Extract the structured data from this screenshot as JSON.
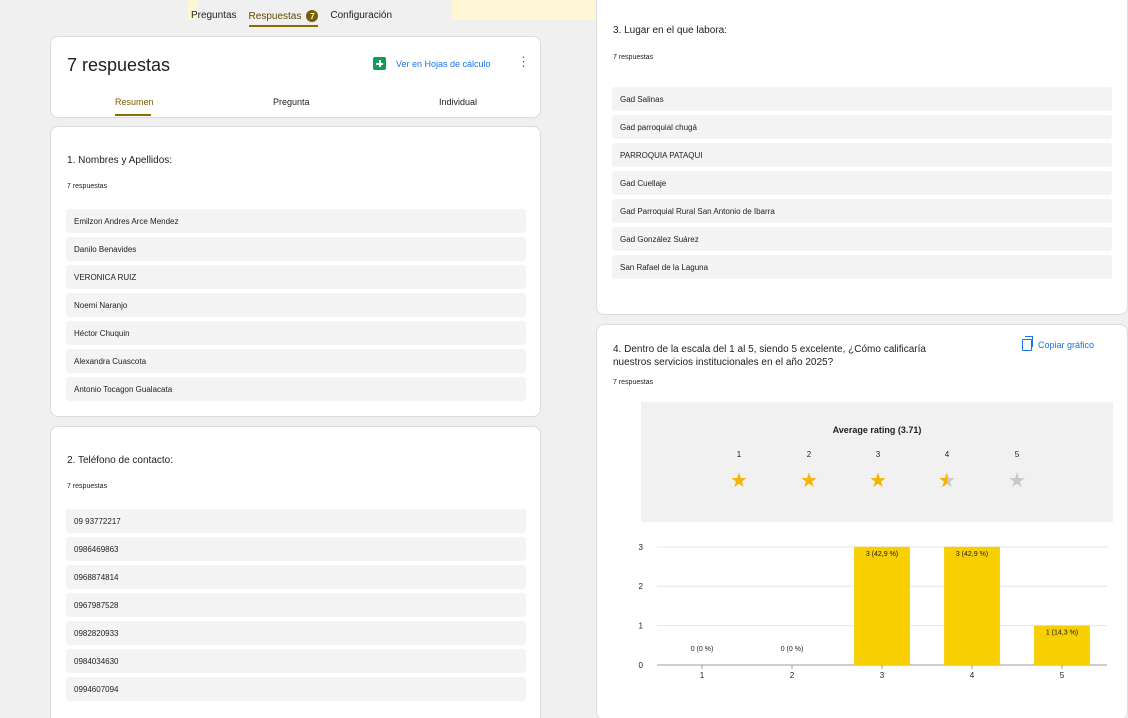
{
  "nav": {
    "tabs": [
      {
        "label": "Preguntas"
      },
      {
        "label": "Respuestas",
        "badge": "7"
      },
      {
        "label": "Configuración"
      }
    ]
  },
  "summary": {
    "title": "7 respuestas",
    "sheets_label": "Ver en Hojas de cálculo",
    "tabs": [
      "Resumen",
      "Pregunta",
      "Individual"
    ]
  },
  "q1": {
    "title": "1.  Nombres y Apellidos:",
    "count": "7 respuestas",
    "answers": [
      "Emilzon Andres Arce Mendez",
      "Danilo Benavides",
      "VERONICA RUIZ",
      "Noemi Naranjo",
      "Héctor Chuquin",
      "Alexandra Cuascota",
      "Antonio Tocagon Gualacata"
    ]
  },
  "q2": {
    "title": "2. Teléfono de contacto:",
    "count": "7 respuestas",
    "answers": [
      "09 93772217",
      "0986469863",
      "0968874814",
      "0967987528",
      "0982820933",
      "0984034630",
      "0994607094"
    ]
  },
  "q3": {
    "title": "3. Lugar en el que labora:",
    "count": "7 respuestas",
    "answers": [
      "Gad Salinas",
      "Gad parroquial chugá",
      "PARROQUIA PATAQUI",
      "Gad Cuellaje",
      "Gad Parroquial Rural San Antonio de Ibarra",
      "Gad González Suárez",
      "San Rafael de la Laguna"
    ]
  },
  "q4": {
    "title_line1": "4. Dentro de la escala del 1 al 5, siendo 5 excelente,  ¿Cómo calificaría",
    "title_line2": "nuestros servicios institucionales en el año 2025?",
    "count": "7 respuestas",
    "copy_label": "Copiar gráfico",
    "rating_label": "Average rating (3.71)",
    "stars": [
      {
        "num": "1",
        "fill": 1
      },
      {
        "num": "2",
        "fill": 1
      },
      {
        "num": "3",
        "fill": 1
      },
      {
        "num": "4",
        "fill": 0.5
      },
      {
        "num": "5",
        "fill": 0
      }
    ]
  },
  "colors": {
    "accent": "#8a6d00",
    "bar": "#f8cf00",
    "link": "#1a73e8",
    "star": "#f5b400"
  },
  "chart_data": {
    "type": "bar",
    "categories": [
      "1",
      "2",
      "3",
      "4",
      "5"
    ],
    "values": [
      0,
      0,
      3,
      3,
      1
    ],
    "data_labels": [
      "0 (0 %)",
      "0 (0 %)",
      "3 (42,9 %)",
      "3 (42,9 %)",
      "1 (14,3 %)"
    ],
    "yticks": [
      "0",
      "1",
      "2",
      "3"
    ],
    "ylim": [
      0,
      3.3
    ],
    "grid": true
  }
}
